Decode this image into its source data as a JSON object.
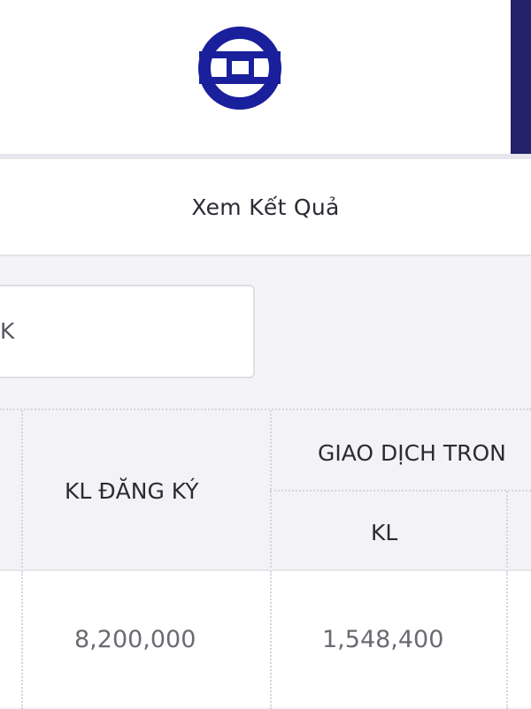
{
  "header": {
    "logo_icon": "exchange-logo-icon",
    "brand_color": "#1a1f9c",
    "accent_strip_color": "#23226a"
  },
  "results_bar": {
    "label": "Xem Kết Quả"
  },
  "filter": {
    "search_value_partial": "K"
  },
  "table": {
    "headers": {
      "registered_volume": "KL ĐĂNG KÝ",
      "group_partial": "GIAO DỊCH TRON",
      "volume": "KL"
    },
    "rows": [
      {
        "registered_volume": "8,200,000",
        "volume": "1,548,400"
      }
    ]
  }
}
